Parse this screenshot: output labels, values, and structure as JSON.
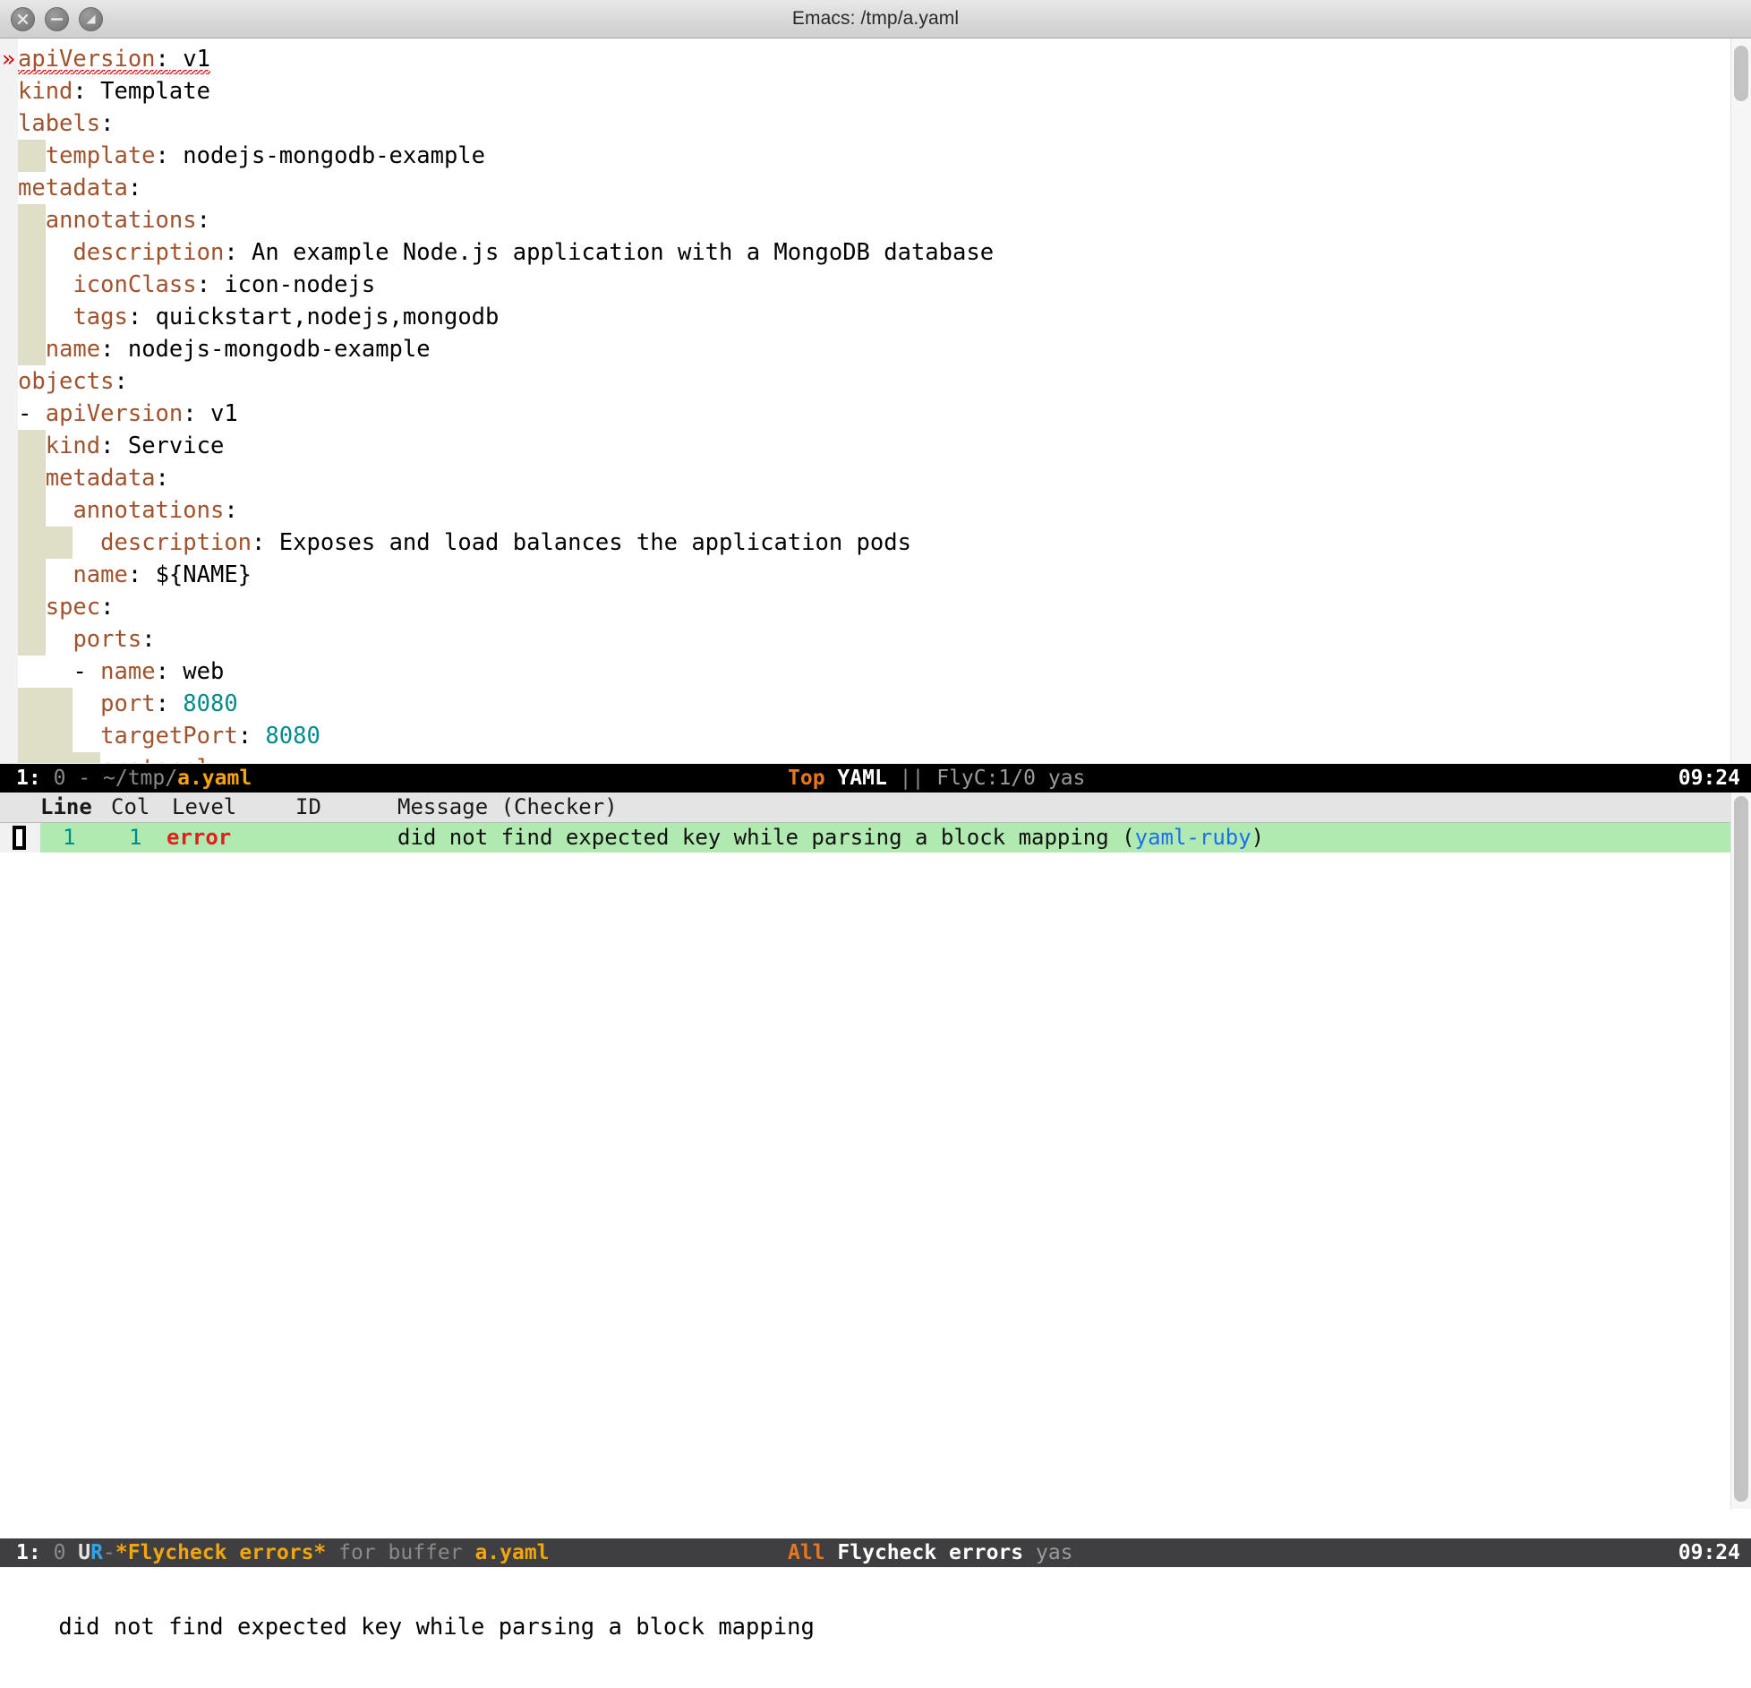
{
  "window": {
    "title": "Emacs: /tmp/a.yaml",
    "buttons": [
      {
        "name": "close-button",
        "glyph": "x"
      },
      {
        "name": "minimize-button",
        "glyph": "-"
      },
      {
        "name": "maximize-button",
        "glyph": "half"
      }
    ]
  },
  "editor": {
    "file": "/tmp/a.yaml",
    "error_marker": "»",
    "lines": [
      {
        "indent": 0,
        "guides": 0,
        "key": "apiVersion",
        "value": "v1",
        "dash": false,
        "spell_error": true
      },
      {
        "indent": 0,
        "guides": 0,
        "key": "kind",
        "value": "Template",
        "dash": false
      },
      {
        "indent": 0,
        "guides": 0,
        "key": "labels",
        "value": "",
        "dash": false
      },
      {
        "indent": 1,
        "guides": 1,
        "key": "template",
        "value": "nodejs-mongodb-example",
        "dash": false
      },
      {
        "indent": 0,
        "guides": 0,
        "key": "metadata",
        "value": "",
        "dash": false
      },
      {
        "indent": 1,
        "guides": 1,
        "key": "annotations",
        "value": "",
        "dash": false
      },
      {
        "indent": 2,
        "guides": 1,
        "key": "description",
        "value": "An example Node.js application with a MongoDB database",
        "dash": false
      },
      {
        "indent": 2,
        "guides": 1,
        "key": "iconClass",
        "value": "icon-nodejs",
        "dash": false
      },
      {
        "indent": 2,
        "guides": 1,
        "key": "tags",
        "value": "quickstart,nodejs,mongodb",
        "dash": false
      },
      {
        "indent": 1,
        "guides": 1,
        "key": "name",
        "value": "nodejs-mongodb-example",
        "dash": false
      },
      {
        "indent": 0,
        "guides": 0,
        "key": "objects",
        "value": "",
        "dash": false
      },
      {
        "indent": 0,
        "guides": 0,
        "key": "apiVersion",
        "value": "v1",
        "dash": true
      },
      {
        "indent": 1,
        "guides": 1,
        "key": "kind",
        "value": "Service",
        "dash": false
      },
      {
        "indent": 1,
        "guides": 1,
        "key": "metadata",
        "value": "",
        "dash": false
      },
      {
        "indent": 2,
        "guides": 1,
        "key": "annotations",
        "value": "",
        "dash": false
      },
      {
        "indent": 3,
        "guides": 2,
        "key": "description",
        "value": "Exposes and load balances the application pods",
        "dash": false
      },
      {
        "indent": 2,
        "guides": 1,
        "key": "name",
        "value": "${NAME}",
        "dash": false
      },
      {
        "indent": 1,
        "guides": 1,
        "key": "spec",
        "value": "",
        "dash": false
      },
      {
        "indent": 2,
        "guides": 1,
        "key": "ports",
        "value": "",
        "dash": false
      },
      {
        "indent": 2,
        "guides": 1,
        "key": "name",
        "value": "web",
        "dash": true
      },
      {
        "indent": 3,
        "guides": 2,
        "key": "port",
        "value": "8080",
        "dash": false,
        "numeric": true
      },
      {
        "indent": 3,
        "guides": 2,
        "key": "targetPort",
        "value": "8080",
        "dash": false,
        "numeric": true
      }
    ]
  },
  "modeline_top": {
    "window_number": "1:",
    "buffer_count": "0",
    "separator": "-",
    "dir": "~/tmp/",
    "file": "a.yaml",
    "position": "Top",
    "major_mode": "YAML",
    "pipe": "||",
    "flycheck": "FlyC:1/0",
    "minor_mode": "yas",
    "time": "09:24"
  },
  "flycheck_list": {
    "headers": [
      "Line",
      "Col",
      "Level",
      "ID",
      "Message (Checker)"
    ],
    "rows": [
      {
        "line": "1",
        "col": "1",
        "level": "error",
        "id": "",
        "message": "did not find expected key while parsing a block mapping",
        "checker": "yaml-ruby"
      }
    ]
  },
  "modeline_bottom": {
    "window_number": "1:",
    "buffer_count": "0",
    "modified": "U",
    "readonly": "R",
    "separator": "-",
    "buffer_name": "*Flycheck errors*",
    "for_buffer": " for buffer ",
    "target_buffer": "a.yaml",
    "position": "All",
    "major_mode": "Flycheck errors",
    "minor_mode": "yas",
    "time": "09:24"
  },
  "echo_area": {
    "message": "did not find expected key while parsing a block mapping"
  },
  "colors": {
    "key": "#a0522d",
    "value": "#000000",
    "number": "#008b8b",
    "error": "#e02020",
    "checker_link": "#1b6ff0",
    "row_highlight": "#b0eab0",
    "indent_guide": "#dfdfc8",
    "modeline_file": "#f2a60c",
    "modeline_pos": "#e8761a"
  }
}
